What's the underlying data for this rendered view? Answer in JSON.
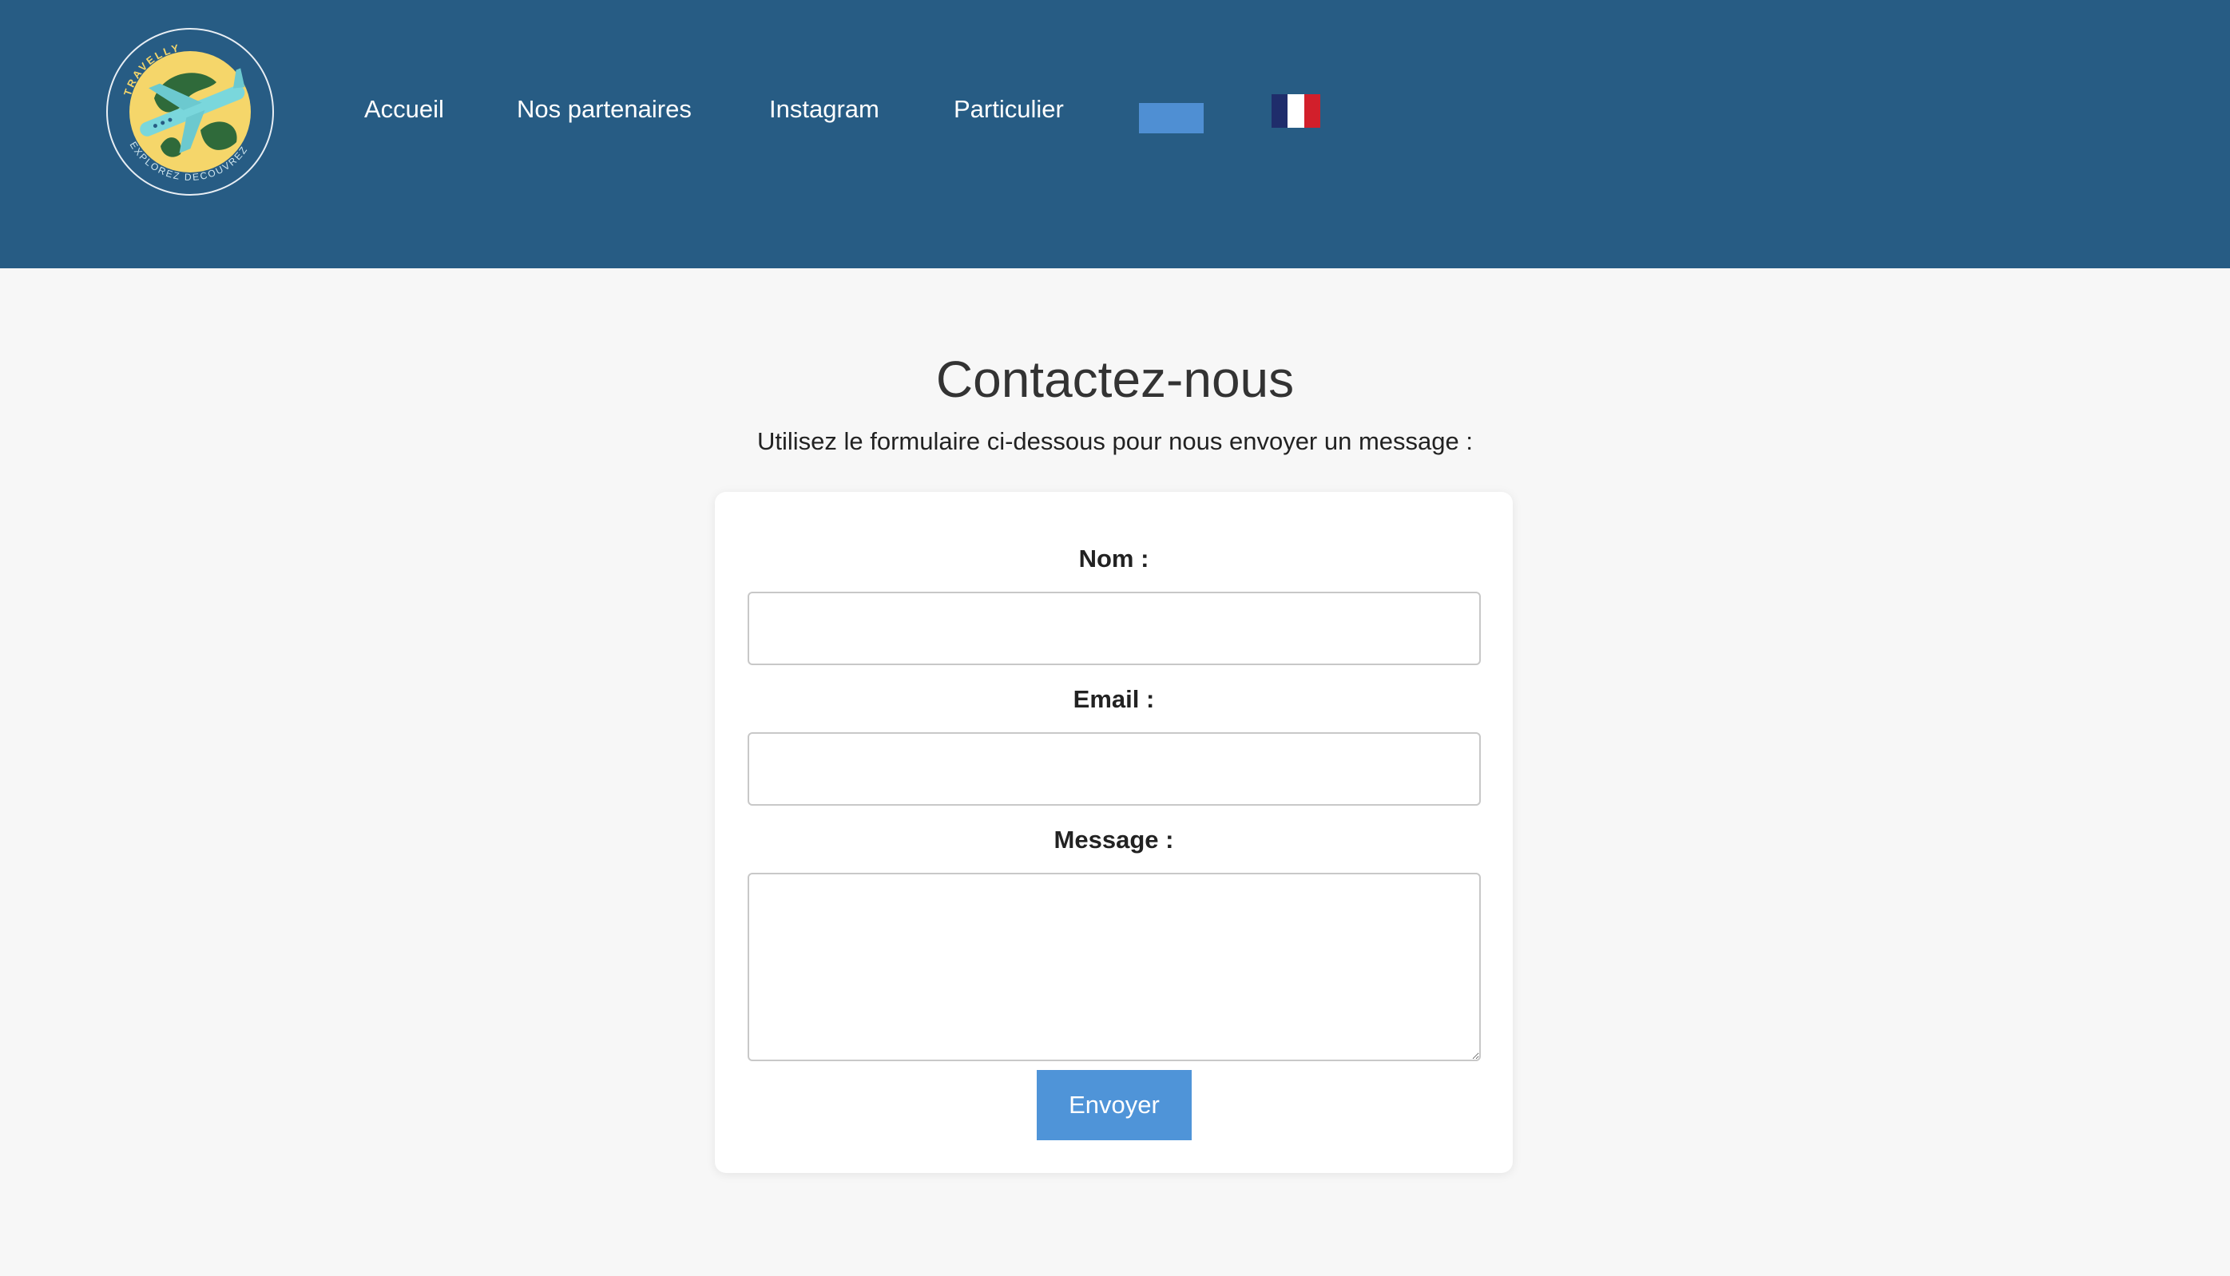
{
  "header": {
    "logo": {
      "top_text": "TRAVELLY",
      "bottom_text": "EXPLOREZ DECOUVREZ",
      "icon": "airplane-globe-icon"
    },
    "nav": [
      {
        "label": "Accueil"
      },
      {
        "label": "Nos partenaires"
      },
      {
        "label": "Instagram"
      },
      {
        "label": "Particulier"
      }
    ],
    "language_placeholder_color": "#4f8fd3",
    "language_flag": "french-flag-icon"
  },
  "main": {
    "title": "Contactez-nous",
    "subtitle": "Utilisez le formulaire ci-dessous pour nous envoyer un message :"
  },
  "form": {
    "name_label": "Nom :",
    "name_value": "",
    "email_label": "Email :",
    "email_value": "",
    "message_label": "Message :",
    "message_value": "",
    "submit_label": "Envoyer"
  },
  "colors": {
    "header_bg": "#275c84",
    "page_bg": "#f7f7f7",
    "button_bg": "#4f94d8",
    "flag_blue": "#1f2d6b",
    "flag_white": "#ffffff",
    "flag_red": "#d21f2b"
  }
}
